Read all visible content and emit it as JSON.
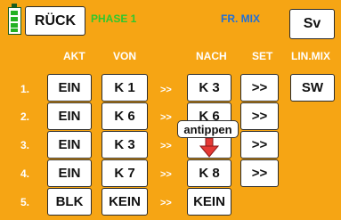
{
  "header": {
    "back_label": "RÜCK",
    "phase": "PHASE 1",
    "title": "FR. MIX",
    "sv_label": "Sv"
  },
  "columns": {
    "akt": "AKT",
    "von": "VON",
    "nach": "NACH",
    "set": "SET",
    "linmix": "LIN.MIX"
  },
  "rows": [
    {
      "num": "1.",
      "akt": "EIN",
      "von": "K 1",
      "arrow": ">>",
      "nach": "K 3",
      "set": ">>",
      "linmix": "SW"
    },
    {
      "num": "2.",
      "akt": "EIN",
      "von": "K 6",
      "arrow": ">>",
      "nach": "K 6",
      "set": ">>"
    },
    {
      "num": "3.",
      "akt": "EIN",
      "von": "K 3",
      "arrow": ">>",
      "nach": "",
      "set": ">>"
    },
    {
      "num": "4.",
      "akt": "EIN",
      "von": "K 7",
      "arrow": ">>",
      "nach": "K 8",
      "set": ">>"
    },
    {
      "num": "5.",
      "akt": "BLK",
      "von": "KEIN",
      "arrow": ">>",
      "nach": "KEIN"
    }
  ],
  "tooltip": {
    "label": "antippen"
  },
  "colors": {
    "background": "#f6a514",
    "accent_green": "#2ec82e",
    "title_blue": "#1e6fd9",
    "pointer_red": "#e53935"
  },
  "icons": {
    "battery": "battery-icon",
    "pointer": "arrow-down-icon"
  }
}
